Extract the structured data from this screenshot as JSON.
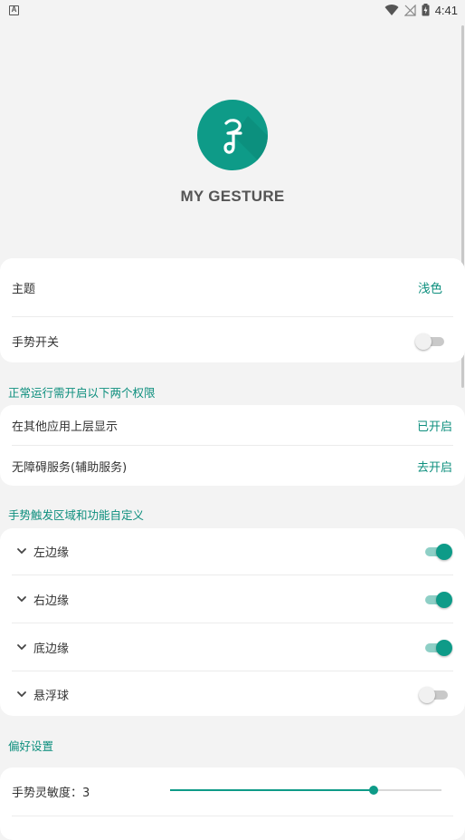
{
  "status_bar": {
    "app_icon_letter": "A",
    "time": "4:41",
    "icons": [
      "wifi-icon",
      "signal-off-icon",
      "battery-charging-icon"
    ]
  },
  "header": {
    "app_title": "MY GESTURE",
    "logo_icon": "gesture-logo-icon",
    "accent_color": "#0e9b88"
  },
  "main_settings": {
    "theme_label": "主题",
    "theme_value": "浅色",
    "gesture_switch_label": "手势开关",
    "gesture_switch_on": false
  },
  "permissions": {
    "section_title": "正常运行需开启以下两个权限",
    "overlay_label": "在其他应用上层显示",
    "overlay_status": "已开启",
    "accessibility_label": "无障碍服务(辅助服务)",
    "accessibility_status": "去开启"
  },
  "gesture_areas": {
    "section_title": "手势触发区域和功能自定义",
    "items": [
      {
        "label": "左边缘",
        "enabled": true
      },
      {
        "label": "右边缘",
        "enabled": true
      },
      {
        "label": "底边缘",
        "enabled": true
      },
      {
        "label": "悬浮球",
        "enabled": false
      }
    ]
  },
  "preferences": {
    "section_title": "偏好设置",
    "sensitivity_label": "手势灵敏度：3",
    "sensitivity_fraction": 0.75
  }
}
